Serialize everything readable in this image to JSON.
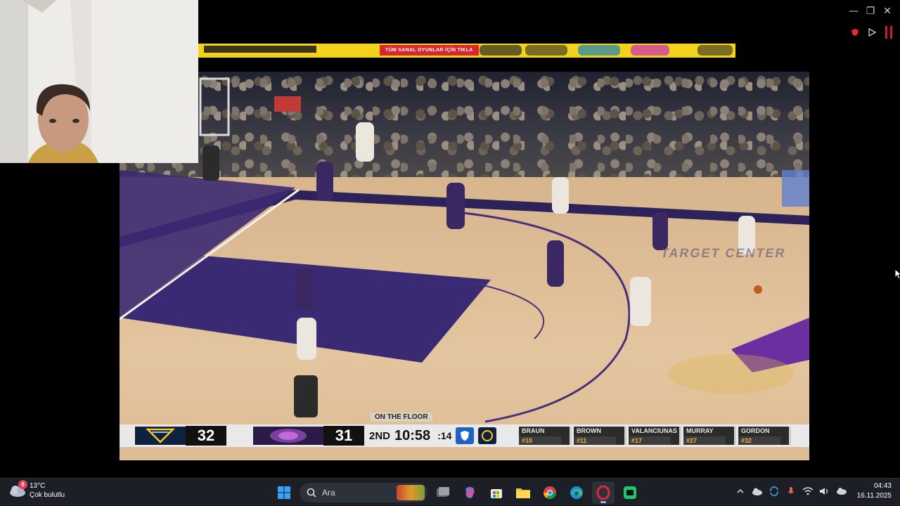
{
  "window": {
    "controls": {
      "minimize": "—",
      "restore": "❐",
      "close": "✕"
    }
  },
  "ad": {
    "cta": "TÜM SANAL OYUNLAR İÇİN TIKLA"
  },
  "video": {
    "arena_text": "TARGET CENTER",
    "on_the_floor_label": "ON THE FLOOR"
  },
  "scorebug": {
    "home_score": "32",
    "away_score": "31",
    "period": "2ND",
    "clock": "10:58",
    "shot_clock": ":14",
    "players": [
      {
        "name": "BRAUN",
        "number": "#10"
      },
      {
        "name": "BROWN",
        "number": "#11"
      },
      {
        "name": "VALANCIUNAS",
        "number": "#17"
      },
      {
        "name": "MURRAY",
        "number": "#27"
      },
      {
        "name": "GORDON",
        "number": "#32"
      }
    ],
    "colors": {
      "nuggets": "#0e2240",
      "nuggets_gold": "#fec524",
      "wolves": "#2b1a47",
      "wolves_purple": "#7b3fa0"
    }
  },
  "taskbar": {
    "weather": {
      "temp": "13°C",
      "desc": "Çok bulutlu",
      "badge": "9"
    },
    "search_placeholder": "Ara",
    "apps": [
      "windows-start",
      "search",
      "task-view",
      "copilot",
      "store",
      "file-explorer",
      "chrome",
      "edge",
      "opera",
      "media-app"
    ],
    "clock": {
      "time": "04:43",
      "date": "16.11.2025"
    }
  }
}
